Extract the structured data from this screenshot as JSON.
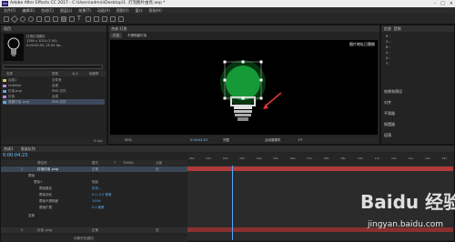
{
  "window": {
    "app_icon": "Ae",
    "title": "Adobe After Effects CC 2017 - C:\\Users\\admin\\Desktop\\1. 灯泡图片由亮.aep *",
    "controls": [
      "–",
      "□",
      "×"
    ]
  },
  "menu": [
    "文件(F)",
    "编辑(E)",
    "合成(C)",
    "图层(L)",
    "效果(T)",
    "动画(A)",
    "视图(V)",
    "窗口",
    "帮助(H)"
  ],
  "project": {
    "tab": "项目",
    "comp_info": [
      "灯泡灯泡图片",
      "1280 x 1024 (1.00)",
      "0:00:05:00, 25.00 fps"
    ],
    "header_cols": [
      "名称",
      "类型",
      "大小",
      "帧速率"
    ],
    "items": [
      {
        "name": "合成1",
        "type": "文件夹",
        "color": "#d6c25b"
      },
      {
        "name": "Untitled",
        "type": "合成",
        "color": "#b58ad9"
      },
      {
        "name": "灯泡.png",
        "type": "PNG 文件",
        "color": "#6aa3d6"
      },
      {
        "name": "灯泡",
        "type": "合成",
        "color": "#b58ad9"
      },
      {
        "name": "遮罩灯泡 .png",
        "type": "PNG 文件",
        "color": "#6aa3d6"
      }
    ],
    "footer": "8 bpc"
  },
  "viewer": {
    "tab": "合成 灯泡",
    "subtab": "灯泡",
    "subtab2": "不透明度灯泡",
    "annotation": "图片地址已替换",
    "zoom": "50%",
    "timecode": "0:00:04:23",
    "quality": "完整",
    "camera": "活动摄像机",
    "views": "1个"
  },
  "right_panel": {
    "info": "信息",
    "audio": "音频",
    "items": [
      "R :",
      "G :",
      "B :",
      "A :",
      "X :",
      "Y :",
      "",
      "",
      "",
      ""
    ],
    "effects": "效果和预设",
    "align": "对齐",
    "smoother": "平滑器",
    "wiggler": "摇摆器",
    "paragraph": "段落",
    "character": "字符"
  },
  "timeline": {
    "tabs": [
      "合成1",
      "渲染队列"
    ],
    "current_time": "0:00:04:23",
    "columns": [
      "源名称",
      "模式",
      "T",
      "TrkMat",
      "父级"
    ],
    "ruler": [
      "00s",
      "01s",
      "02s",
      "03s",
      "04s",
      "05s",
      "06s",
      "07s",
      "08s",
      "09s",
      "10s",
      "11s",
      "12s",
      "13s",
      "14s",
      "15s"
    ],
    "layers": [
      {
        "num": "1",
        "name": "灯泡灯泡 .png",
        "mode": "正常",
        "parent": "无"
      },
      {
        "num": "2",
        "name": "灯泡 .png",
        "mode": "正常",
        "parent": "无"
      }
    ],
    "props": [
      {
        "label": "蒙版",
        "value": ""
      },
      {
        "label": "蒙版1",
        "value": "相加"
      },
      {
        "label": "蒙版路径",
        "value": "形状..."
      },
      {
        "label": "蒙版羽化",
        "value": "0.0, 0.0 像素"
      },
      {
        "label": "蒙版不透明度",
        "value": "100%"
      },
      {
        "label": "蒙版扩展",
        "value": "0.0 像素"
      },
      {
        "label": "变换",
        "value": "重置"
      }
    ],
    "footer": "切换开关/模式"
  },
  "watermark": {
    "brand": "Baidu 经验",
    "url": "jingyan.baidu.com"
  }
}
